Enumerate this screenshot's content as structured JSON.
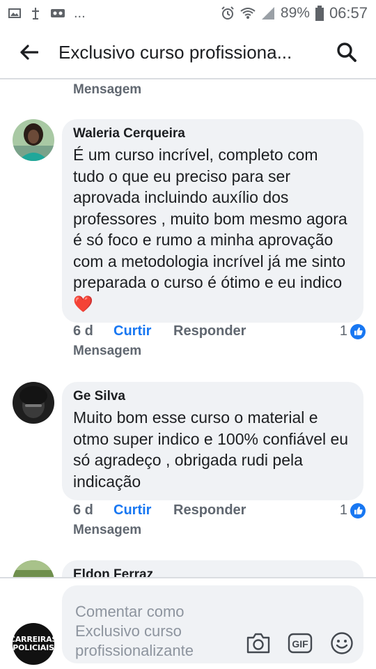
{
  "status_bar": {
    "dots": "...",
    "battery": "89%",
    "time": "06:57"
  },
  "header": {
    "title": "Exclusivo curso profissiona..."
  },
  "feed": {
    "top_message_link": "Mensagem",
    "comments": [
      {
        "author": "Waleria Cerqueira",
        "text": "É um curso incrível, completo com tudo o que eu preciso para ser aprovada incluindo auxílio dos professores , muito bom mesmo agora é só foco e rumo a minha aprovação com a metodologia incrível já me sinto preparada o curso é ótimo e eu indico",
        "emoji": "❤️",
        "time": "6 d",
        "like_label": "Curtir",
        "reply_label": "Responder",
        "like_count": "1",
        "message_link": "Mensagem"
      },
      {
        "author": "Ge Silva",
        "text": "Muito bom esse curso o  material e otmo super indico  e 100%  confiável eu só agradeço  , obrigada  rudi pela indicação",
        "time": "6 d",
        "like_label": "Curtir",
        "reply_label": "Responder",
        "like_count": "1",
        "message_link": "Mensagem"
      },
      {
        "author": "Eldon Ferraz"
      }
    ]
  },
  "composer": {
    "placeholder": "Comentar como Exclusivo curso profissionalizante",
    "page_avatar_text": [
      "CARREIRAS",
      "POLICIAIS"
    ],
    "camera_icon": "camera-icon",
    "gif_label": "GIF",
    "emoji_icon": "smiley-icon"
  },
  "colors": {
    "accent": "#1877f2",
    "bubble": "#f0f2f5",
    "secondary_text": "#606770",
    "heart": "#e41e3f"
  }
}
